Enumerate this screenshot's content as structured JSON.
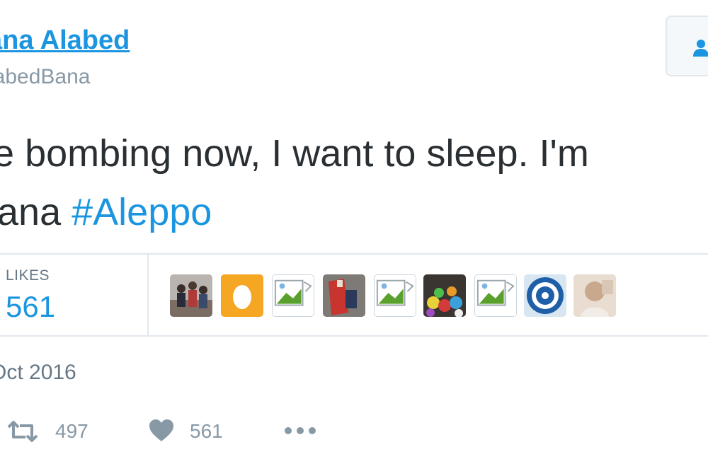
{
  "user": {
    "name": "ana Alabed",
    "handle": "AlabedBana"
  },
  "tweet": {
    "line1": "he bombing now, I want to sleep. I'm",
    "line2_prefix": " Bana ",
    "hashtag": "#Aleppo"
  },
  "stats": {
    "likes_label": "LIKES",
    "likes_count": "561"
  },
  "likers": [
    {
      "icon": "group-photo-avatar"
    },
    {
      "icon": "egg-avatar",
      "color": "#f5a623"
    },
    {
      "icon": "broken-image-avatar"
    },
    {
      "icon": "red-flag-photo-avatar"
    },
    {
      "icon": "broken-image-avatar"
    },
    {
      "icon": "colorful-balls-avatar"
    },
    {
      "icon": "broken-image-avatar"
    },
    {
      "icon": "blue-emblem-avatar"
    },
    {
      "icon": "portrait-photo-avatar"
    }
  ],
  "meta": {
    "date": "Oct 2016"
  },
  "actions": {
    "retweet_count": "497",
    "like_count": "561"
  },
  "colors": {
    "link": "#1b95e0",
    "muted": "#8899a6",
    "text": "#292f33"
  }
}
